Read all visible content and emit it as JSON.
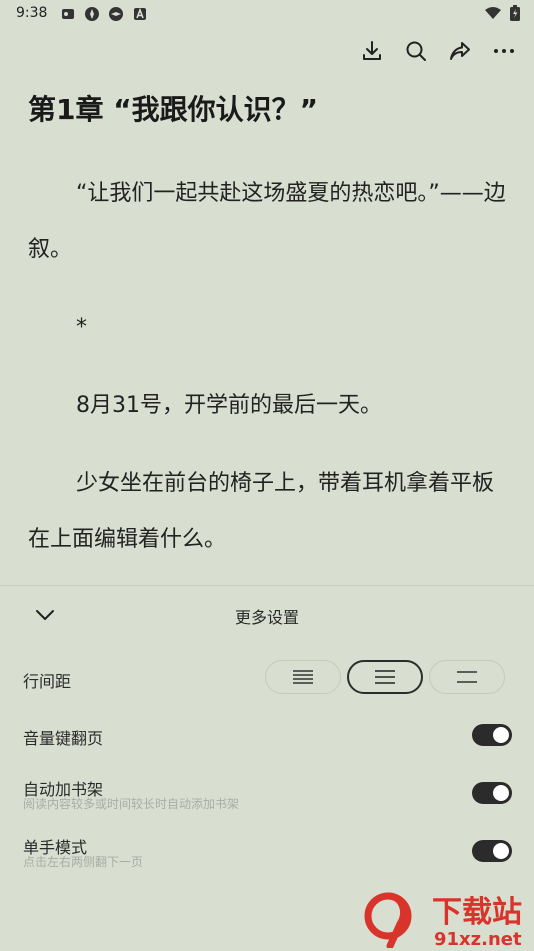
{
  "status_bar": {
    "time": "9:38",
    "left_icons": [
      "sim-icon",
      "app-icon",
      "app-icon",
      "notification-icon"
    ],
    "right_icons": [
      "wifi-icon",
      "battery-icon"
    ]
  },
  "toolbar": {
    "icons": [
      "download-icon",
      "search-icon",
      "share-icon",
      "more-icon"
    ]
  },
  "reader": {
    "chapter_title": "第1章 “我跟你认识？”",
    "paragraphs": [
      "“让我们一起共赴这场盛夏的热恋吧。”——边叙。",
      "*",
      "8月31号，开学前的最后一天。",
      "少女坐在前台的椅子上，带着耳机拿着平板在上面编辑着什么。"
    ]
  },
  "settings": {
    "title": "更多设置",
    "line_spacing_label": "行间距",
    "line_spacing_options": [
      "compact",
      "normal",
      "wide"
    ],
    "line_spacing_selected": "normal",
    "volume_key_label": "音量键翻页",
    "volume_key_on": true,
    "auto_shelf_label": "自动加书架",
    "auto_shelf_desc": "阅读内容较多或时间较长时自动添加书架",
    "auto_shelf_on": true,
    "one_hand_label": "单手模式",
    "one_hand_desc": "点击左右两侧翻下一页",
    "one_hand_on": true
  },
  "watermark": {
    "text_cn": "下载站",
    "text_url": "91xz.net"
  },
  "colors": {
    "background": "#d8dfd0",
    "text": "#222222",
    "toggle_on": "#2b2b2b",
    "watermark_red": "#d9342b"
  }
}
